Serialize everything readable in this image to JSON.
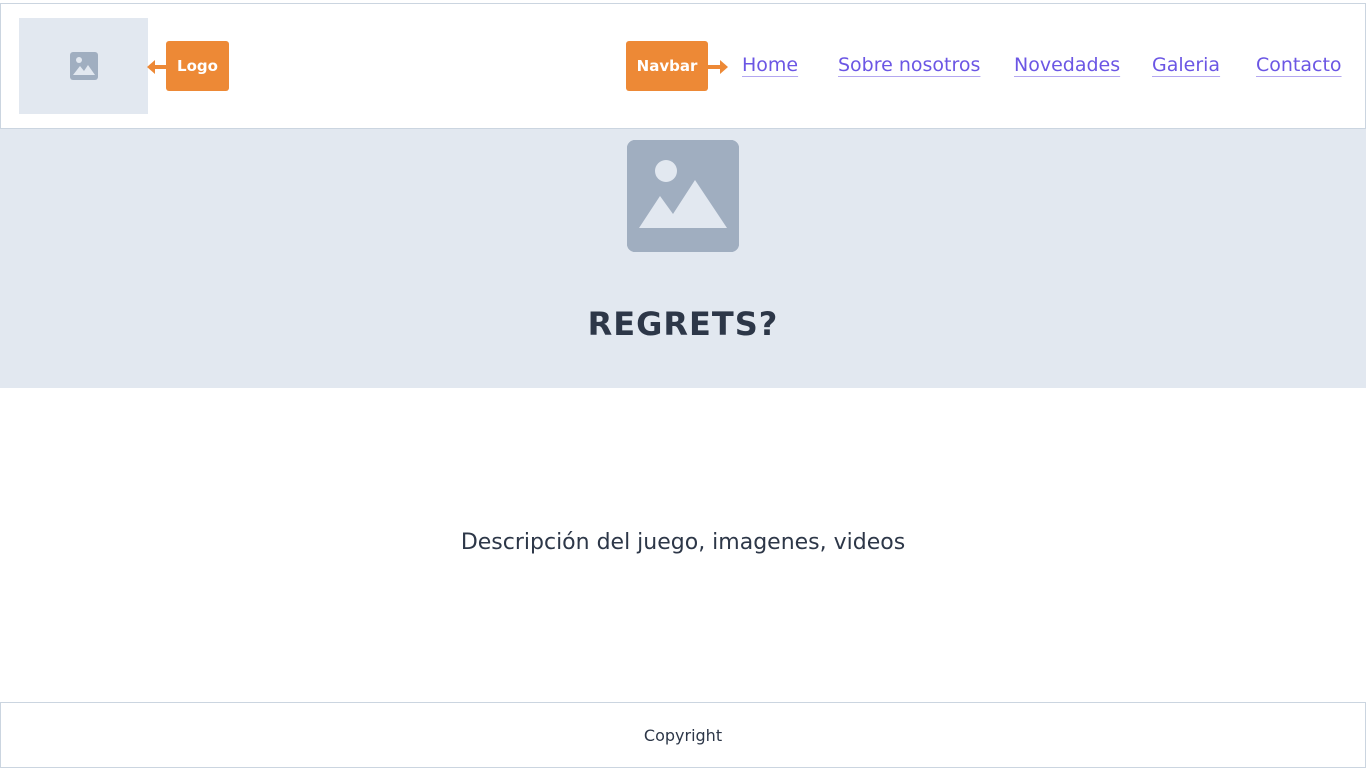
{
  "header": {
    "logo_icon": "image-placeholder-icon",
    "logo_tag": "Logo",
    "navbar_tag": "Navbar",
    "nav": [
      {
        "label": "Home"
      },
      {
        "label": "Sobre nosotros"
      },
      {
        "label": "Novedades"
      },
      {
        "label": "Galeria"
      },
      {
        "label": "Contacto"
      }
    ]
  },
  "hero": {
    "image_icon": "image-placeholder-icon",
    "title": "REGRETS?"
  },
  "main": {
    "description": "Descripción del juego, imagenes, videos"
  },
  "footer": {
    "text": "Copyright"
  },
  "colors": {
    "accent": "#ed8936",
    "link": "#6b56e4",
    "placeholder_bg": "#e2e8f0",
    "placeholder_icon": "#a0aec0",
    "text": "#2d3748"
  }
}
